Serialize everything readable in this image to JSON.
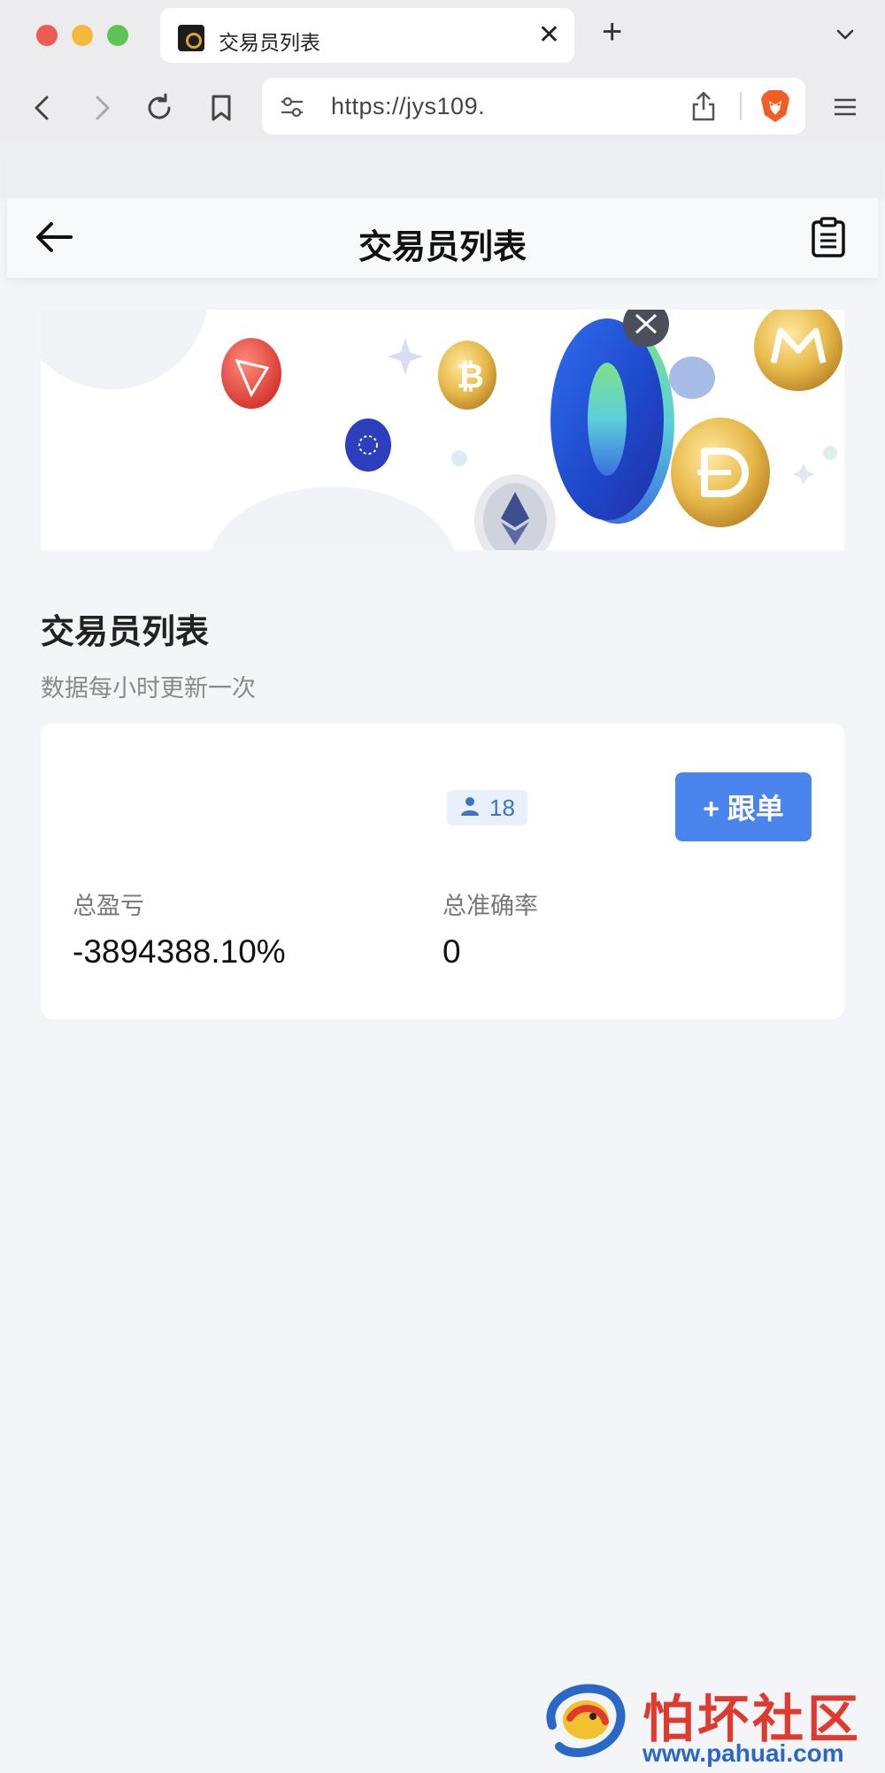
{
  "browser": {
    "tab_title": "交易员列表",
    "url": "https://jys109."
  },
  "header": {
    "title": "交易员列表"
  },
  "section": {
    "title": "交易员列表",
    "subtitle": "数据每小时更新一次"
  },
  "trader": {
    "followers": "18",
    "follow_label": "+ 跟单",
    "pnl_label": "总盈亏",
    "pnl_value": "-3894388.10%",
    "accuracy_label": "总准确率",
    "accuracy_value": "0"
  },
  "watermark": {
    "text": "怕坏社区",
    "url": "www.pahuai.com"
  },
  "colors": {
    "accent": "#4a85ee",
    "follower_badge": "#eaf0fb",
    "page_bg": "#f4f5f8"
  },
  "icons": [
    "back-arrow-icon",
    "clipboard-icon",
    "user-icon",
    "brave-lion-icon",
    "share-icon",
    "reload-icon",
    "bookmark-icon"
  ]
}
